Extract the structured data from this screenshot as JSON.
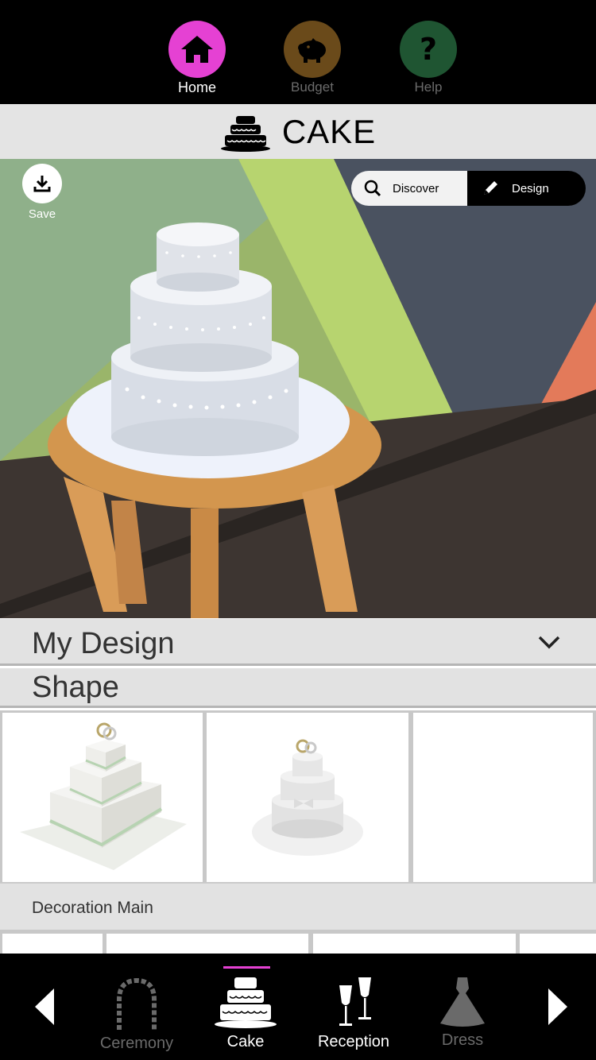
{
  "topnav": {
    "home_label": "Home",
    "budget_label": "Budget",
    "help_label": "Help",
    "help_glyph": "?",
    "colors": {
      "home": "#e541d3",
      "budget": "#6a4a1a",
      "help": "#1f5532"
    }
  },
  "header": {
    "title": "CAKE",
    "icon": "cake-icon"
  },
  "ar_view": {
    "save_label": "Save",
    "mode_toggle": {
      "discover_label": "Discover",
      "design_label": "Design",
      "active": "Design"
    }
  },
  "panel": {
    "my_design_label": "My Design",
    "shape_label": "Shape",
    "decoration_label": "Decoration Main",
    "shape_options": [
      {
        "name": "square-tiered-cake"
      },
      {
        "name": "round-tiered-cake"
      },
      {
        "name": "empty"
      }
    ]
  },
  "bottomnav": {
    "items": [
      {
        "label": "Ceremony",
        "icon": "arch-icon",
        "active": false
      },
      {
        "label": "Cake",
        "icon": "cake-icon",
        "active": true
      },
      {
        "label": "Reception",
        "icon": "champagne-icon",
        "active": false
      },
      {
        "label": "Dress",
        "icon": "dress-icon",
        "active": false
      }
    ],
    "accent": "#e541d3"
  }
}
